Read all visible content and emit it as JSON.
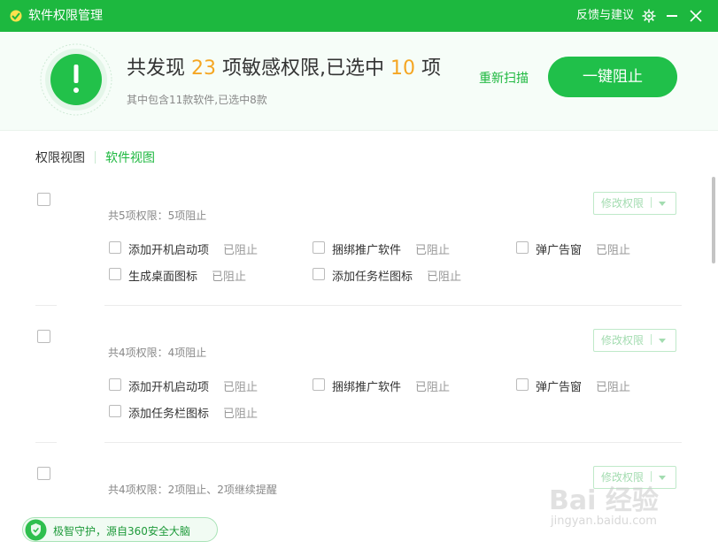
{
  "window": {
    "title": "软件权限管理",
    "feedback": "反馈与建议"
  },
  "header": {
    "prefix": "共发现 ",
    "found_count": "23",
    "middle": " 项敏感权限,已选中 ",
    "selected_count": "10",
    "suffix": " 项",
    "subline": "其中包含11款软件,已选中8款",
    "rescan_label": "重新扫描",
    "block_all_label": "一键阻止"
  },
  "tabs": {
    "permission_view": "权限视图",
    "software_view": "软件视图"
  },
  "modify_label": "修改权限",
  "groups": [
    {
      "summary": "共5项权限：5项阻止",
      "items": [
        {
          "name": "添加开机启动项",
          "state": "已阻止"
        },
        {
          "name": "捆绑推广软件",
          "state": "已阻止"
        },
        {
          "name": "弹广告窗",
          "state": "已阻止"
        },
        {
          "name": "生成桌面图标",
          "state": "已阻止"
        },
        {
          "name": "添加任务栏图标",
          "state": "已阻止"
        }
      ]
    },
    {
      "summary": "共4项权限：4项阻止",
      "items": [
        {
          "name": "添加开机启动项",
          "state": "已阻止"
        },
        {
          "name": "捆绑推广软件",
          "state": "已阻止"
        },
        {
          "name": "弹广告窗",
          "state": "已阻止"
        },
        {
          "name": "添加任务栏图标",
          "state": "已阻止"
        }
      ]
    },
    {
      "summary": "共4项权限：2项阻止、2项继续提醒",
      "items": []
    }
  ],
  "guard": {
    "label": "极智守护，源自360安全大脑"
  },
  "watermark": {
    "text": "Bai 经验",
    "url": "jingyan.baidu.com"
  },
  "colors": {
    "brand_green": "#1db83f",
    "count_orange": "#f5a623"
  },
  "icons": [
    "app-logo-icon",
    "gear-icon",
    "minimize-icon",
    "close-icon",
    "alert-shield-icon",
    "guard-shield-icon"
  ]
}
